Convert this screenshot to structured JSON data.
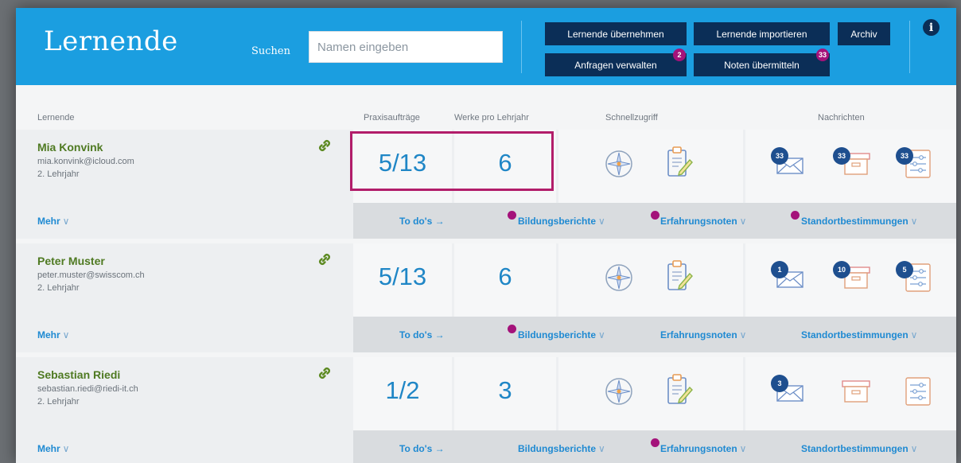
{
  "header": {
    "title": "Lernende",
    "search_label": "Suchen",
    "search_placeholder": "Namen eingeben",
    "buttons": {
      "uebernehmen": "Lernende übernehmen",
      "importieren": "Lernende importieren",
      "archiv": "Archiv",
      "anfragen": "Anfragen verwalten",
      "noten": "Noten übermitteln"
    },
    "badges": {
      "anfragen": "2",
      "noten": "33"
    },
    "info_icon": "info-icon"
  },
  "columns": {
    "lernende": "Lernende",
    "praxisauftraege": "Praxisaufträge",
    "werke": "Werke pro Lehrjahr",
    "schnellzugriff": "Schnellzugriff",
    "nachrichten": "Nachrichten"
  },
  "labels": {
    "mehr": "Mehr",
    "todos": "To do's →",
    "bildungsberichte": "Bildungsberichte",
    "erfahrungsnoten": "Erfahrungsnoten",
    "standortbestimmungen": "Standortbestimmungen",
    "chevron": "∨"
  },
  "learners": [
    {
      "name": "Mia Konvink",
      "email": "mia.konvink@icloud.com",
      "year": "2. Lehrjahr",
      "praxis": "5/13",
      "werke": "6",
      "msg_badges": [
        "33",
        "33",
        "33"
      ],
      "dots": [
        true,
        true,
        true
      ]
    },
    {
      "name": "Peter Muster",
      "email": "peter.muster@swisscom.ch",
      "year": "2. Lehrjahr",
      "praxis": "5/13",
      "werke": "6",
      "msg_badges": [
        "1",
        "10",
        "5"
      ],
      "dots": [
        true,
        false,
        false
      ]
    },
    {
      "name": "Sebastian Riedi",
      "email": "sebastian.riedi@riedi-it.ch",
      "year": "2. Lehrjahr",
      "praxis": "1/2",
      "werke": "3",
      "msg_badges": [
        "3",
        "",
        ""
      ],
      "dots": [
        false,
        true,
        false
      ]
    }
  ],
  "colors": {
    "header": "#1b9ee0",
    "button": "#0b2e57",
    "accent_badge": "#a4127a",
    "name_green": "#4f7a22",
    "link_blue": "#1f8ad2",
    "highlight": "#b21d6a"
  }
}
